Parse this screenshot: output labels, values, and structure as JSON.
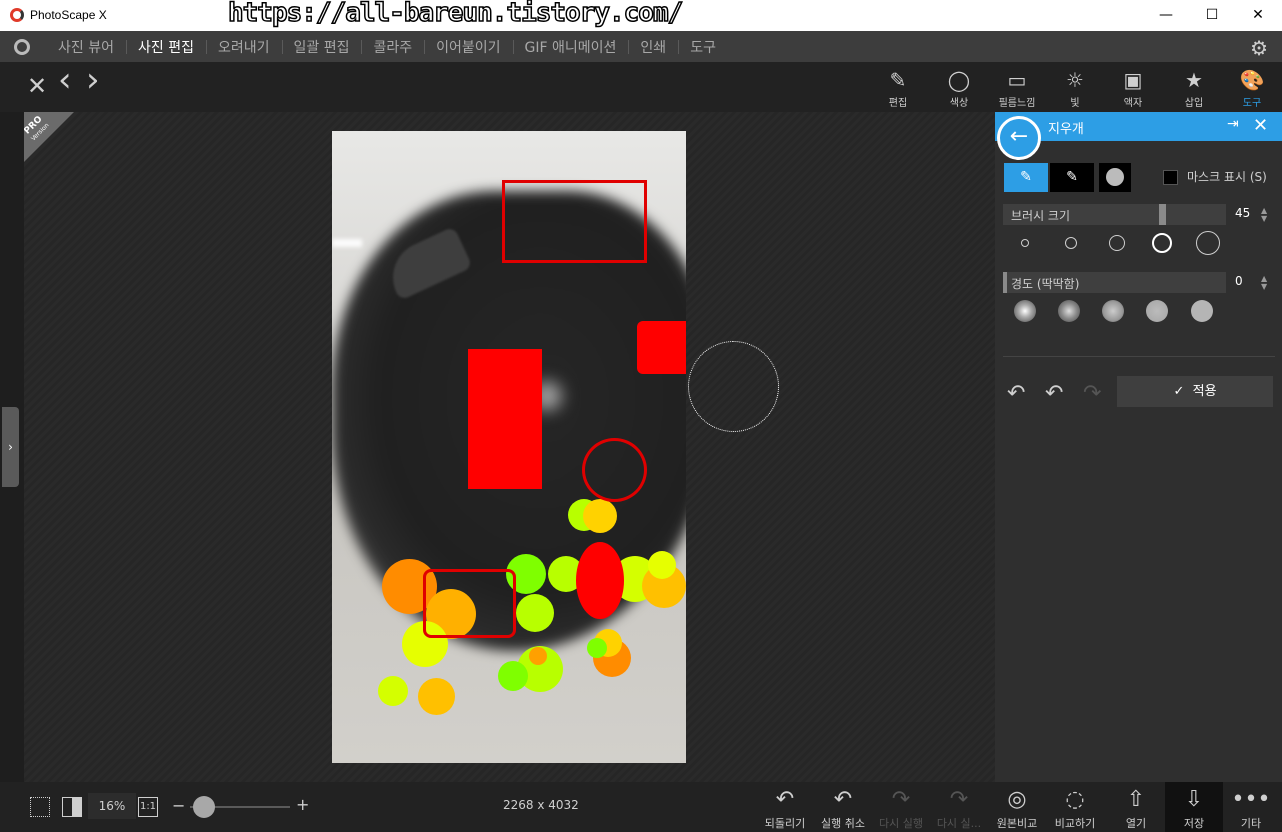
{
  "window": {
    "title": "PhotoScape X",
    "watermark": "https://all-bareun.tistory.com/",
    "minimize": "—",
    "maximize": "☐",
    "close": "✕"
  },
  "menu": {
    "items": [
      {
        "label": "사진 뷰어",
        "active": false
      },
      {
        "label": "사진 편집",
        "active": true
      },
      {
        "label": "오려내기",
        "active": false
      },
      {
        "label": "일괄 편집",
        "active": false
      },
      {
        "label": "콜라주",
        "active": false
      },
      {
        "label": "이어붙이기",
        "active": false
      },
      {
        "label": "GIF 애니메이션",
        "active": false
      },
      {
        "label": "인쇄",
        "active": false
      },
      {
        "label": "도구",
        "active": false
      }
    ]
  },
  "toolbar": {
    "close_symbol": "✕",
    "prev_symbol": "‹",
    "next_symbol": "›",
    "tools": [
      {
        "label": "편집",
        "icon": "✎",
        "active": false
      },
      {
        "label": "색상",
        "icon": "◯",
        "active": false
      },
      {
        "label": "필름느낌",
        "icon": "▭",
        "active": false
      },
      {
        "label": "빛",
        "icon": "☼",
        "active": false
      },
      {
        "label": "액자",
        "icon": "▣",
        "active": false
      },
      {
        "label": "삽입",
        "icon": "★",
        "active": false
      },
      {
        "label": "도구",
        "icon": "🎨",
        "active": true
      }
    ]
  },
  "badge": {
    "line1": "PRO",
    "line2": "Version"
  },
  "panel": {
    "title": "지우개",
    "back_symbol": "←",
    "pin_symbol": "⇥",
    "close_symbol": "✕",
    "mask_label": "마스크 표시 (S)",
    "brush_size": {
      "label": "브러시 크기",
      "value": "45",
      "level": 0.72
    },
    "hardness": {
      "label": "경도 (딱딱함)",
      "value": "0",
      "level": 0.0
    },
    "apply_label": "적용",
    "apply_check": "✓"
  },
  "bottom": {
    "zoom": "16%",
    "one_to_one": "1:1",
    "minus": "−",
    "plus": "+",
    "zoom_level": 0.16,
    "dimensions": "2268 x 4032",
    "actions": [
      {
        "label": "되돌리기",
        "icon": "↶",
        "disabled": false
      },
      {
        "label": "실행 취소",
        "icon": "↶",
        "disabled": false
      },
      {
        "label": "다시 실행",
        "icon": "↷",
        "disabled": true
      },
      {
        "label": "다시 실...",
        "icon": "↷",
        "disabled": true
      },
      {
        "label": "원본비교",
        "icon": "◎",
        "disabled": false
      },
      {
        "label": "비교하기",
        "icon": "◌",
        "disabled": false
      },
      {
        "label": "열기",
        "icon": "⇧",
        "disabled": false
      },
      {
        "label": "저장",
        "icon": "⇩",
        "disabled": false
      },
      {
        "label": "기타",
        "icon": "•••",
        "disabled": false
      }
    ]
  },
  "colors": {
    "accent": "#2d9ee5",
    "red": "#ff0000"
  }
}
